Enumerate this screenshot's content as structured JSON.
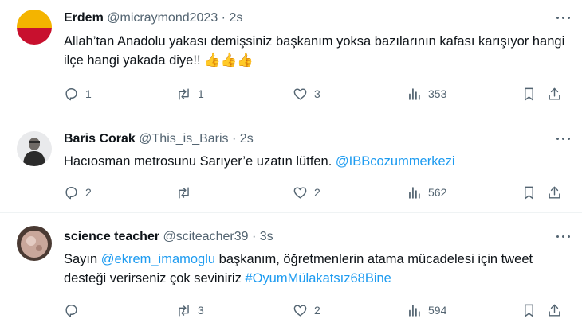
{
  "tweets": [
    {
      "name": "Erdem",
      "handle": "@micraymond2023",
      "time": "2s",
      "text": "Allah’tan Anadolu yakası demişsiniz başkanım yoksa bazılarının kafası karışıyor hangi ilçe hangi yakada diye!! ",
      "emoji": "👍👍👍",
      "replies": "1",
      "retweets": "1",
      "likes": "3",
      "views": "353",
      "avatar_colors": [
        "#f4b400",
        "#c8102e"
      ]
    },
    {
      "name": "Baris Corak",
      "handle": "@This_is_Baris",
      "time": "2s",
      "text_plain": "Hacıosman metrosunu Sarıyer’e uzatın lütfen. ",
      "mention": "@IBBcozummerkezi",
      "replies": "2",
      "retweets": "",
      "likes": "2",
      "views": "562"
    },
    {
      "name": "science teacher",
      "handle": "@sciteacher39",
      "time": "3s",
      "text_prefix": "Sayın ",
      "mention": "@ekrem_imamoglu",
      "text_mid": " başkanım, öğretmenlerin atama mücadelesi için tweet desteği verirseniz çok seviniriz ",
      "hashtag": "#OyumMülakatsız68Bine",
      "replies": "",
      "retweets": "3",
      "likes": "2",
      "views": "594"
    }
  ],
  "separator": "·",
  "colors": {
    "text": "#0f1419",
    "secondary": "#536471",
    "link": "#1d9bf0",
    "divider": "#eff3f4"
  }
}
